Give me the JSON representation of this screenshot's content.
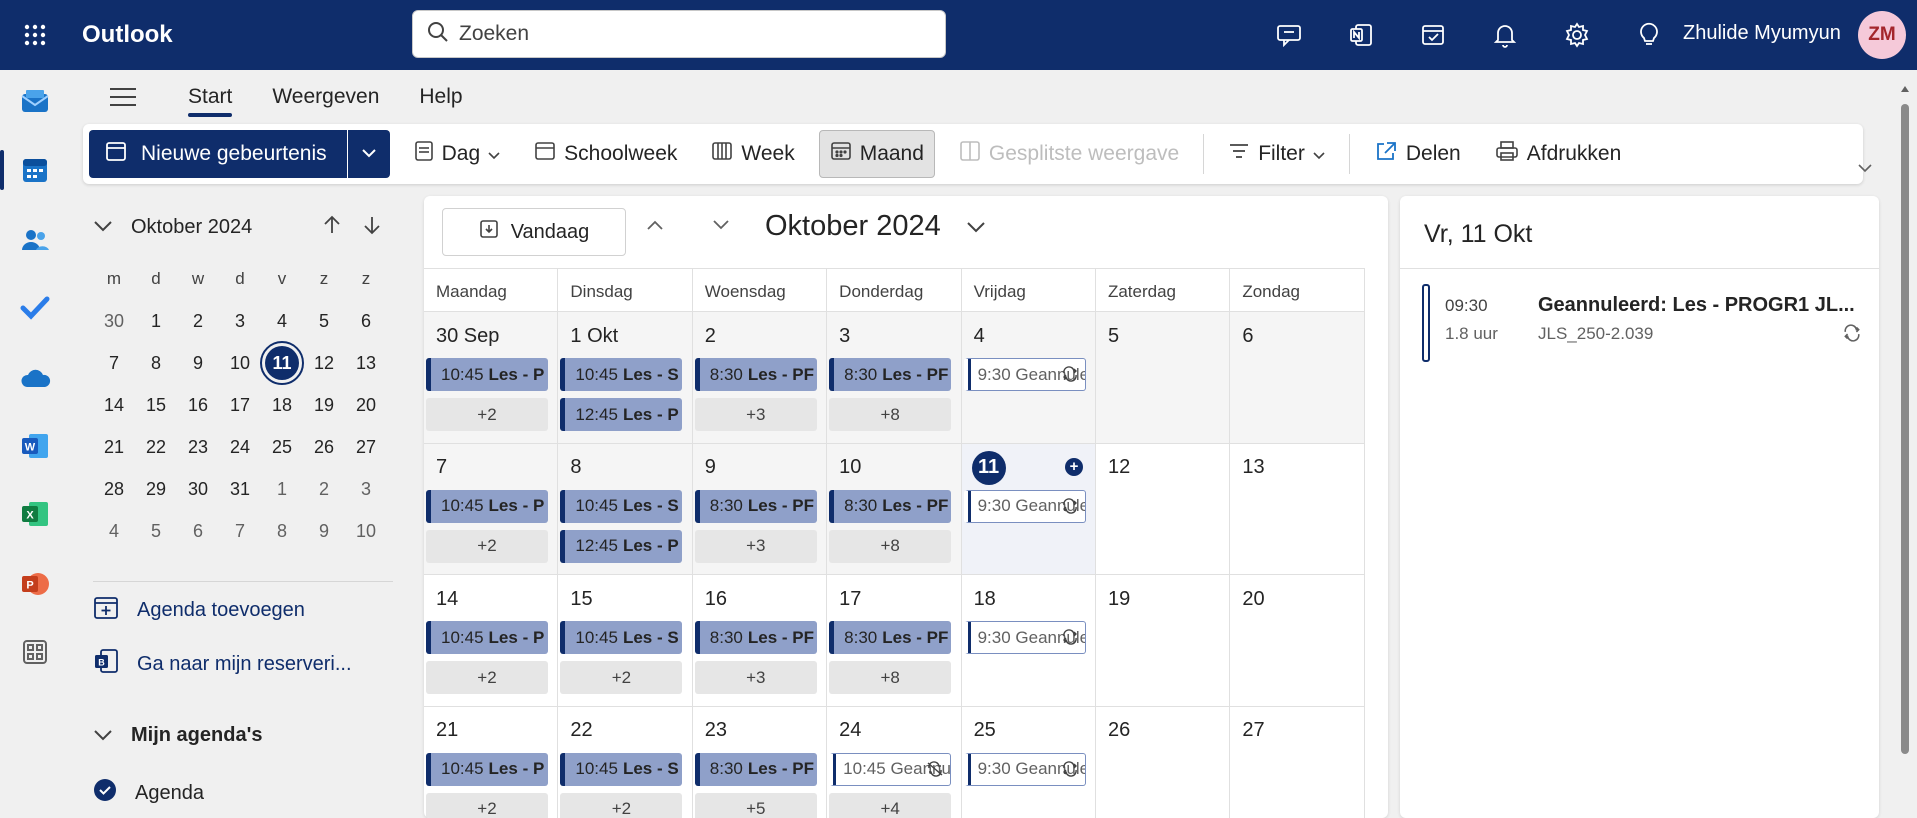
{
  "app": {
    "name": "Outlook"
  },
  "search": {
    "placeholder": "Zoeken"
  },
  "user": {
    "name": "Zhulide Myumyun",
    "initials": "ZM"
  },
  "ribbon": {
    "tabs": [
      "Start",
      "Weergeven",
      "Help"
    ],
    "active": "Start"
  },
  "toolbar": {
    "new_event": "Nieuwe gebeurtenis",
    "day": "Dag",
    "workweek": "Schoolweek",
    "week": "Week",
    "month": "Maand",
    "split": "Gesplitste weergave",
    "filter": "Filter",
    "share": "Delen",
    "print": "Afdrukken"
  },
  "mini_calendar": {
    "title": "Oktober 2024",
    "weekdays": [
      "m",
      "d",
      "w",
      "d",
      "v",
      "z",
      "z"
    ],
    "weeks": [
      [
        "30",
        "1",
        "2",
        "3",
        "4",
        "5",
        "6"
      ],
      [
        "7",
        "8",
        "9",
        "10",
        "11",
        "12",
        "13"
      ],
      [
        "14",
        "15",
        "16",
        "17",
        "18",
        "19",
        "20"
      ],
      [
        "21",
        "22",
        "23",
        "24",
        "25",
        "26",
        "27"
      ],
      [
        "28",
        "29",
        "30",
        "31",
        "1",
        "2",
        "3"
      ],
      [
        "4",
        "5",
        "6",
        "7",
        "8",
        "9",
        "10"
      ]
    ],
    "today": "11"
  },
  "left_links": {
    "add_calendar": "Agenda toevoegen",
    "reservations": "Ga naar mijn reserveri...",
    "my_calendars": "Mijn agenda's",
    "calendar": "Agenda"
  },
  "main": {
    "today_btn": "Vandaag",
    "month_title": "Oktober 2024",
    "weekdays": [
      "Maandag",
      "Dinsdag",
      "Woensdag",
      "Donderdag",
      "Vrijdag",
      "Zaterdag",
      "Zondag"
    ],
    "weeks": [
      {
        "days": [
          {
            "num": "30 Sep",
            "events": [
              {
                "time": "10:45",
                "title": "Les - P"
              }
            ],
            "more": "+2"
          },
          {
            "num": "1 Okt",
            "events": [
              {
                "time": "10:45",
                "title": "Les - S"
              },
              {
                "time": "12:45",
                "title": "Les - P"
              }
            ]
          },
          {
            "num": "2",
            "events": [
              {
                "time": "8:30",
                "title": "Les - PF"
              }
            ],
            "more": "+3"
          },
          {
            "num": "3",
            "events": [
              {
                "time": "8:30",
                "title": "Les - PF"
              }
            ],
            "more": "+8"
          },
          {
            "num": "4",
            "outline": {
              "time": "9:30",
              "title": "Geannuleerd"
            }
          },
          {
            "num": "5"
          },
          {
            "num": "6"
          }
        ]
      },
      {
        "days": [
          {
            "num": "7",
            "events": [
              {
                "time": "10:45",
                "title": "Les - P"
              }
            ],
            "more": "+2"
          },
          {
            "num": "8",
            "events": [
              {
                "time": "10:45",
                "title": "Les - S"
              },
              {
                "time": "12:45",
                "title": "Les - P"
              }
            ]
          },
          {
            "num": "9",
            "events": [
              {
                "time": "8:30",
                "title": "Les - PF"
              }
            ],
            "more": "+3"
          },
          {
            "num": "10",
            "events": [
              {
                "time": "8:30",
                "title": "Les - PF"
              }
            ],
            "more": "+8"
          },
          {
            "num": "11",
            "today": true,
            "outline": {
              "time": "9:30",
              "title": "Geannuleerd"
            }
          },
          {
            "num": "12"
          },
          {
            "num": "13"
          }
        ]
      },
      {
        "days": [
          {
            "num": "14",
            "events": [
              {
                "time": "10:45",
                "title": "Les - P"
              }
            ],
            "more": "+2"
          },
          {
            "num": "15",
            "events": [
              {
                "time": "10:45",
                "title": "Les - S"
              }
            ],
            "more": "+2"
          },
          {
            "num": "16",
            "events": [
              {
                "time": "8:30",
                "title": "Les - PF"
              }
            ],
            "more": "+3"
          },
          {
            "num": "17",
            "events": [
              {
                "time": "8:30",
                "title": "Les - PF"
              }
            ],
            "more": "+8"
          },
          {
            "num": "18",
            "outline": {
              "time": "9:30",
              "title": "Geannuleerd"
            }
          },
          {
            "num": "19"
          },
          {
            "num": "20"
          }
        ]
      },
      {
        "days": [
          {
            "num": "21",
            "events": [
              {
                "time": "10:45",
                "title": "Les - P"
              }
            ],
            "more": "+2"
          },
          {
            "num": "22",
            "events": [
              {
                "time": "10:45",
                "title": "Les - S"
              }
            ],
            "more": "+2"
          },
          {
            "num": "23",
            "events": [
              {
                "time": "8:30",
                "title": "Les - PF"
              }
            ],
            "more": "+5"
          },
          {
            "num": "24",
            "outline": {
              "time": "10:45",
              "title": "Geannuleerd"
            },
            "more": "+4"
          },
          {
            "num": "25",
            "outline": {
              "time": "9:30",
              "title": "Geannuleerd"
            }
          },
          {
            "num": "26"
          },
          {
            "num": "27"
          }
        ]
      }
    ]
  },
  "right_pane": {
    "title": "Vr, 11 Okt",
    "event": {
      "time": "09:30",
      "duration": "1.8 uur",
      "title": "Geannuleerd: Les - PROGR1 JL...",
      "location": "JLS_250-2.039"
    }
  },
  "colors": {
    "brand": "#0f2d6b",
    "event_fill": "#8fa0c9"
  }
}
